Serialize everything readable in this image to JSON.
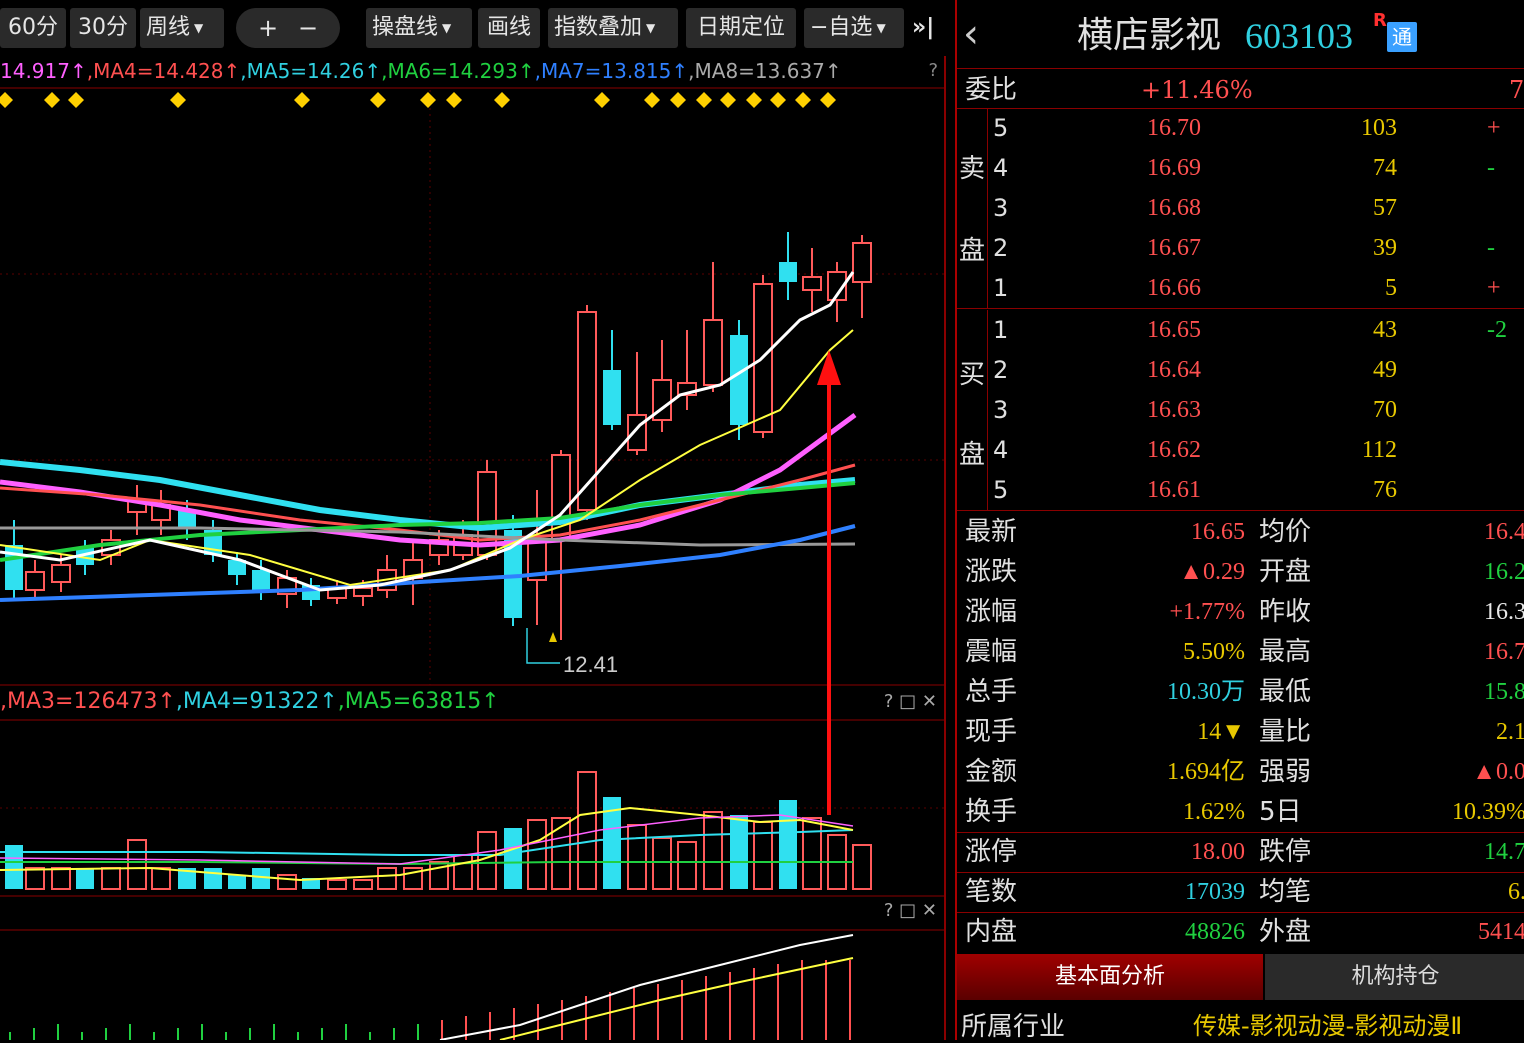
{
  "toolbar": {
    "p60": "60分",
    "p30": "30分",
    "weekly": "周线",
    "plus": "+",
    "minus": "−",
    "trade_line": "操盘线",
    "draw": "画线",
    "overlay": "指数叠加",
    "date_locate": "日期定位",
    "watchlist": "−自选",
    "next": "»|"
  },
  "ma_line": {
    "ma3": "14.917↑",
    "ma4": "MA4=14.428↑",
    "ma5": "MA5=14.26↑",
    "ma6": "MA6=14.293↑",
    "ma7": "MA7=13.815↑",
    "ma8": "MA8=13.637↑",
    "help": "?"
  },
  "chart_marks": {
    "low_label": "12.41"
  },
  "volume_label": {
    "ma3": ",MA3=126473↑",
    "ma4": ",MA4=91322↑",
    "ma5": ",MA5=63815↑",
    "controls": "? □ ✕"
  },
  "lower_controls": "? □ ✕",
  "chart_data": {
    "type": "candlestick",
    "low_marker": 12.41,
    "volume_ma": {
      "MA3": 126473,
      "MA4": 91322,
      "MA5": 63815
    },
    "price_ma": {
      "MA3": 14.917,
      "MA4": 14.428,
      "MA5": 14.26,
      "MA6": 14.293,
      "MA7": 13.815,
      "MA8": 13.637
    }
  },
  "quote": {
    "back": "‹",
    "name": "横店影视",
    "code": "603103",
    "badge_r": "R",
    "badge_tong": "通",
    "webi_label": "委比",
    "webi_value": "+11.46%",
    "webi_extra": "7",
    "sell_label_1": "卖",
    "sell_label_2": "盘",
    "buy_label_1": "买",
    "buy_label_2": "盘",
    "sell": [
      {
        "level": "5",
        "price": "16.70",
        "vol": "103",
        "chg": "+"
      },
      {
        "level": "4",
        "price": "16.69",
        "vol": "74",
        "chg": "-"
      },
      {
        "level": "3",
        "price": "16.68",
        "vol": "57",
        "chg": ""
      },
      {
        "level": "2",
        "price": "16.67",
        "vol": "39",
        "chg": "-"
      },
      {
        "level": "1",
        "price": "16.66",
        "vol": "5",
        "chg": "+"
      }
    ],
    "buy": [
      {
        "level": "1",
        "price": "16.65",
        "vol": "43",
        "chg": "-2"
      },
      {
        "level": "2",
        "price": "16.64",
        "vol": "49",
        "chg": ""
      },
      {
        "level": "3",
        "price": "16.63",
        "vol": "70",
        "chg": ""
      },
      {
        "level": "4",
        "price": "16.62",
        "vol": "112",
        "chg": ""
      },
      {
        "level": "5",
        "price": "16.61",
        "vol": "76",
        "chg": ""
      }
    ],
    "stats": [
      {
        "l1": "最新",
        "v1": "16.65",
        "c1": "#ff5050",
        "l2": "均价",
        "v2": "16.4",
        "c2": "#ff5050"
      },
      {
        "l1": "涨跌",
        "v1": "▲0.29",
        "c1": "#ff5050",
        "l2": "开盘",
        "v2": "16.2",
        "c2": "#20d040"
      },
      {
        "l1": "涨幅",
        "v1": "+1.77%",
        "c1": "#ff5050",
        "l2": "昨收",
        "v2": "16.3",
        "c2": "#e8e8e8"
      },
      {
        "l1": "震幅",
        "v1": "5.50%",
        "c1": "#e8c800",
        "l2": "最高",
        "v2": "16.7",
        "c2": "#ff5050"
      },
      {
        "l1": "总手",
        "v1": "10.30万",
        "c1": "#30d0e0",
        "l2": "最低",
        "v2": "15.8",
        "c2": "#20d040"
      },
      {
        "l1": "现手",
        "v1": "14▼",
        "c1": "#e8c800",
        "l2": "量比",
        "v2": "2.1",
        "c2": "#e8c800"
      },
      {
        "l1": "金额",
        "v1": "1.694亿",
        "c1": "#e8c800",
        "l2": "强弱",
        "v2": "▲0.0",
        "c2": "#ff5050"
      },
      {
        "l1": "换手",
        "v1": "1.62%",
        "c1": "#e8c800",
        "l2": "5日",
        "v2": "10.39%",
        "c2": "#e8c800"
      },
      {
        "l1": "涨停",
        "v1": "18.00",
        "c1": "#ff5050",
        "l2": "跌停",
        "v2": "14.7",
        "c2": "#20d040"
      },
      {
        "l1": "笔数",
        "v1": "17039",
        "c1": "#30d0e0",
        "l2": "均笔",
        "v2": "6.",
        "c2": "#e8c800"
      },
      {
        "l1": "内盘",
        "v1": "48826",
        "c1": "#20d040",
        "l2": "外盘",
        "v2": "5414",
        "c2": "#ff5050"
      }
    ],
    "tab_fundamental": "基本面分析",
    "tab_institution": "机构持仓",
    "industry_label": "所属行业",
    "industry_value": "传媒-影视动漫-影视动漫Ⅱ"
  }
}
